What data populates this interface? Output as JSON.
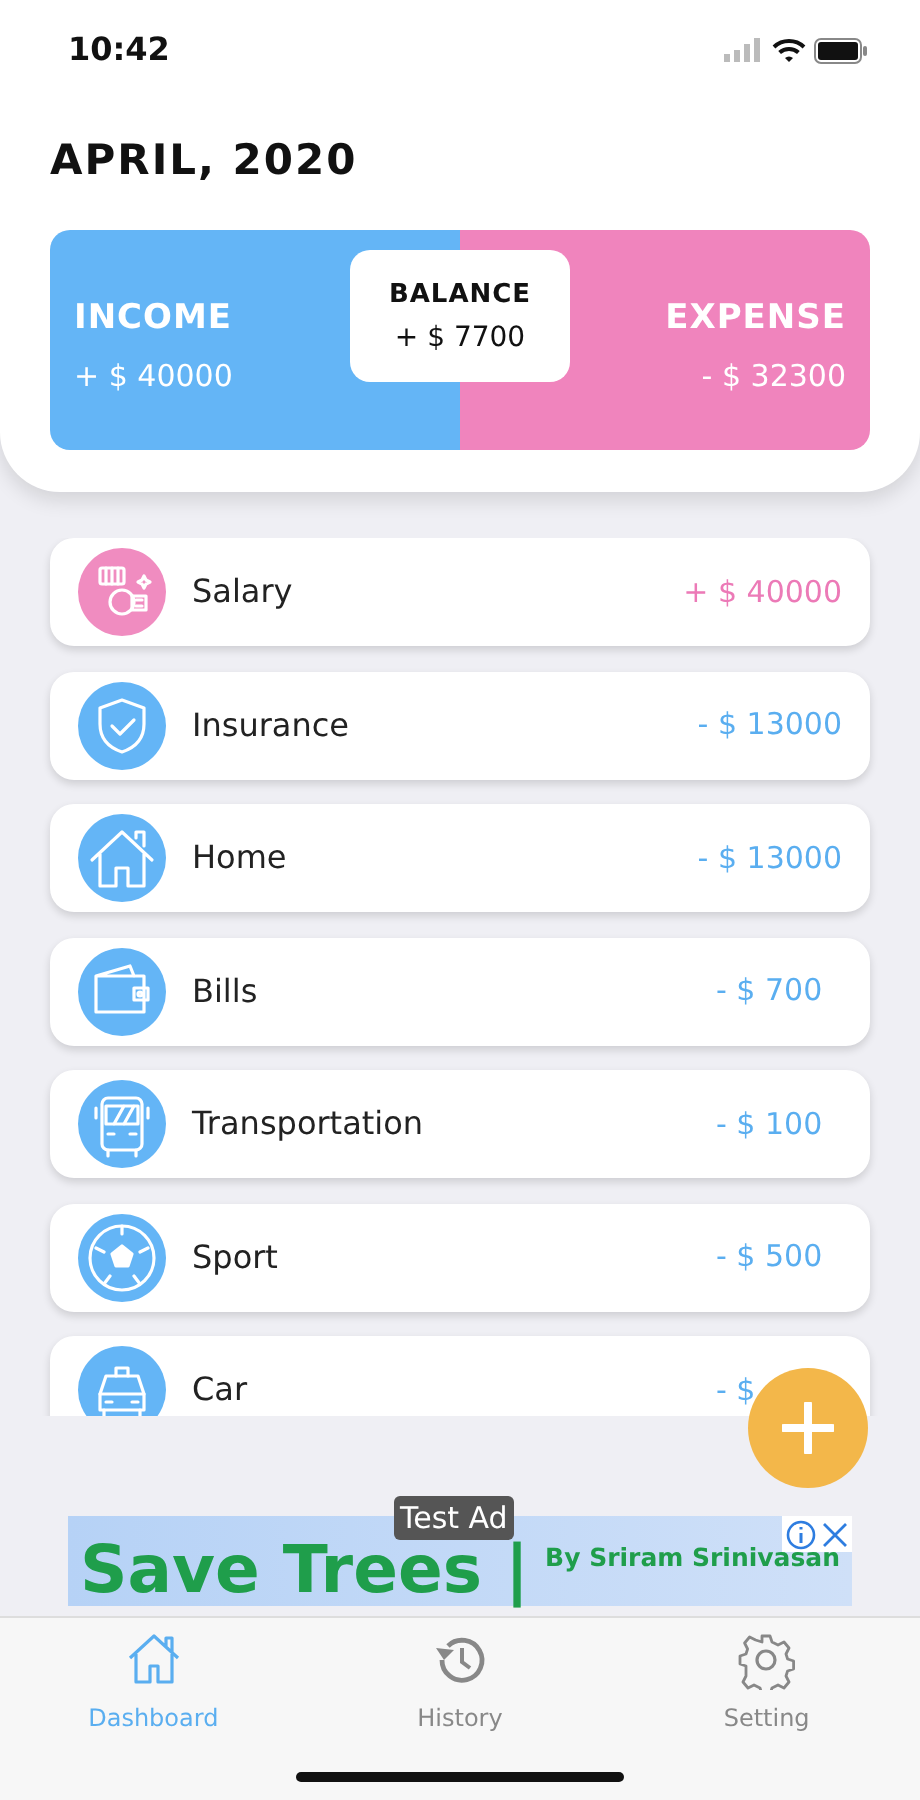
{
  "status_bar": {
    "time": "10:42"
  },
  "header": {
    "title": "APRIL, 2020"
  },
  "summary": {
    "income": {
      "label": "INCOME",
      "amount": "+ $ 40000"
    },
    "balance": {
      "label": "BALANCE",
      "amount": "+ $ 7700"
    },
    "expense": {
      "label": "EXPENSE",
      "amount": "- $ 32300"
    }
  },
  "transactions": [
    {
      "kind": "income",
      "category": "Salary",
      "amount": "+ $ 40000"
    },
    {
      "kind": "expense",
      "category": "Insurance",
      "amount": "- $ 13000"
    },
    {
      "kind": "expense",
      "category": "Home",
      "amount": "- $ 13000"
    },
    {
      "kind": "expense",
      "category": "Bills",
      "amount": "- $ 700"
    },
    {
      "kind": "expense",
      "category": "Transportation",
      "amount": "- $ 100"
    },
    {
      "kind": "expense",
      "category": "Sport",
      "amount": "- $ 500"
    },
    {
      "kind": "expense",
      "category": "Car",
      "amount": "- $"
    }
  ],
  "ad": {
    "badge": "Test Ad",
    "headline": "Save Trees |",
    "byline": "By Sriram Srinivasan"
  },
  "tabs": [
    {
      "label": "Dashboard",
      "selected": true
    },
    {
      "label": "History",
      "selected": false
    },
    {
      "label": "Setting",
      "selected": false
    }
  ]
}
